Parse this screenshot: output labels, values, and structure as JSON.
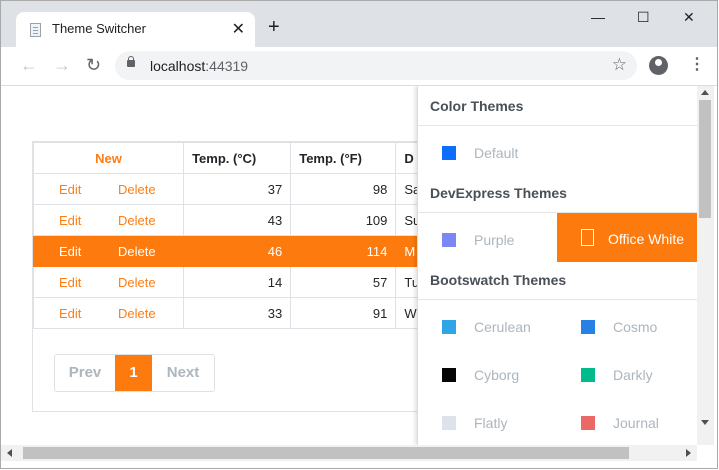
{
  "browser": {
    "tab_title": "Theme Switcher",
    "tab_close": "✕",
    "new_tab": "+",
    "url_host": "localhost",
    "url_port": ":44319",
    "window_minimize": "—",
    "window_maximize": "☐",
    "window_close": "✕",
    "back": "←",
    "forward": "→",
    "reload": "↻",
    "bookmark_star": "☆",
    "menu": "⋮"
  },
  "grid": {
    "new_label": "New",
    "columns": [
      "Temp. (°C)",
      "Temp. (°F)",
      "D"
    ],
    "edit_label": "Edit",
    "delete_label": "Delete",
    "rows": [
      {
        "c": "37",
        "f": "98",
        "d": "Sa"
      },
      {
        "c": "43",
        "f": "109",
        "d": "Su"
      },
      {
        "c": "46",
        "f": "114",
        "d": "M",
        "selected": true
      },
      {
        "c": "14",
        "f": "57",
        "d": "Tu"
      },
      {
        "c": "33",
        "f": "91",
        "d": "W"
      }
    ],
    "pager": {
      "prev": "Prev",
      "page": "1",
      "next": "Next"
    }
  },
  "themes": {
    "color_header": "Color Themes",
    "devexpress_header": "DevExpress Themes",
    "bootswatch_header": "Bootswatch Themes",
    "color": [
      {
        "name": "Default",
        "color": "#0d6efd"
      }
    ],
    "devexpress": [
      {
        "name": "Purple",
        "color": "#7d86f5"
      },
      {
        "name": "Office White",
        "color": "#fd7a0e",
        "active": true
      }
    ],
    "bootswatch": [
      {
        "name": "Cerulean",
        "color": "#2fa4e7"
      },
      {
        "name": "Cosmo",
        "color": "#2780e3"
      },
      {
        "name": "Cyborg",
        "color": "#060606"
      },
      {
        "name": "Darkly",
        "color": "#00bc8c"
      },
      {
        "name": "Flatly",
        "color": "#dce3ea"
      },
      {
        "name": "Journal",
        "color": "#eb6864"
      }
    ]
  },
  "colors": {
    "accent": "#fd7a0e",
    "muted_text": "#adb5bd"
  }
}
